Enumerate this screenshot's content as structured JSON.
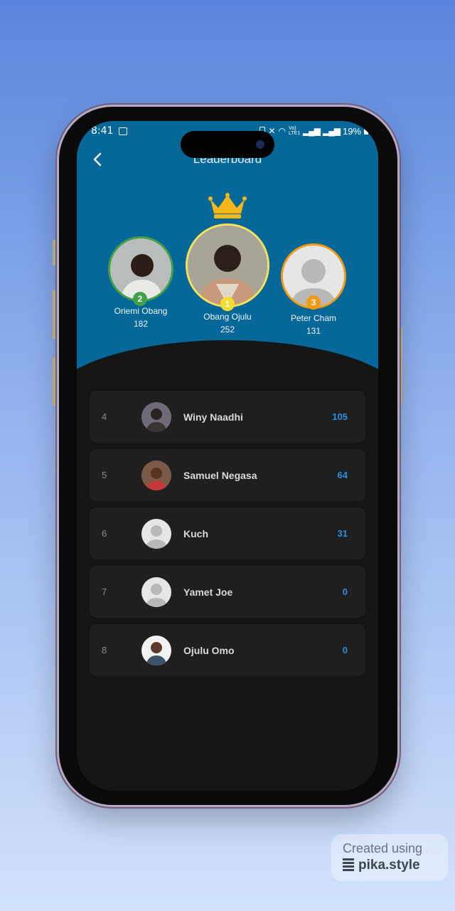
{
  "status_bar": {
    "time": "8:41",
    "network": "Vo) LTE1",
    "battery": "19%"
  },
  "header": {
    "title": "Leaderboard"
  },
  "podium": [
    {
      "rank": "2",
      "name": "Oriemi Obang",
      "score": "182",
      "ring_color": "#43a047",
      "badge_color": "#43a047"
    },
    {
      "rank": "1",
      "name": "Obang Ojulu",
      "score": "252",
      "ring_color": "#f3e25a",
      "badge_color": "#f3dd2f"
    },
    {
      "rank": "3",
      "name": "Peter Cham",
      "score": "131",
      "ring_color": "#f29b12",
      "badge_color": "#f29b12"
    }
  ],
  "list": [
    {
      "rank": "4",
      "name": "Winy Naadhi",
      "score": "105",
      "avatar": "photo"
    },
    {
      "rank": "5",
      "name": "Samuel Negasa",
      "score": "64",
      "avatar": "photo"
    },
    {
      "rank": "6",
      "name": "Kuch",
      "score": "31",
      "avatar": "placeholder"
    },
    {
      "rank": "7",
      "name": "Yamet Joe",
      "score": "0",
      "avatar": "placeholder"
    },
    {
      "rank": "8",
      "name": "Ojulu Omo",
      "score": "0",
      "avatar": "photo"
    }
  ],
  "watermark": {
    "line1": "Created using",
    "line2": "pika.style"
  },
  "colors": {
    "header_bg": "#056899",
    "screen_bg": "#151515",
    "row_bg": "#1f1f1f",
    "score": "#2a8ee0",
    "crown": "#f6b617"
  },
  "icons": {
    "back": "chevron-left-icon",
    "crown": "crown-icon",
    "placeholder": "person-placeholder-icon"
  }
}
